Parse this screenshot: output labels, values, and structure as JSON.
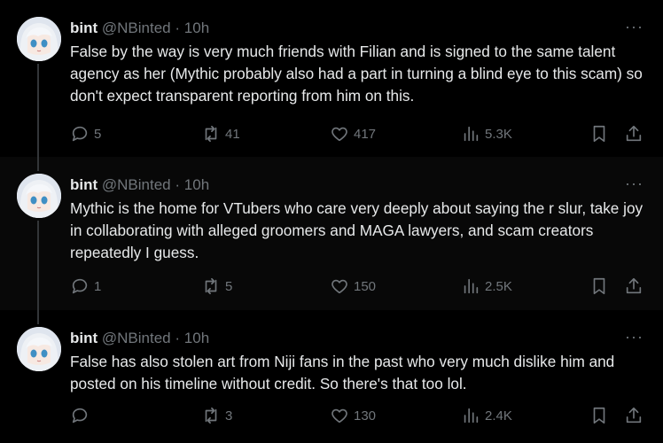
{
  "author": {
    "name": "bint",
    "handle": "@NBinted",
    "separator": "·"
  },
  "tweets": [
    {
      "time": "10h",
      "text": "False by the way is very much friends with Filian and is signed to the same talent agency as her (Mythic probably also had a part in turning a blind eye to this scam) so don't expect transparent reporting from him on this.",
      "replies": "5",
      "reposts": "41",
      "likes": "417",
      "views": "5.3K"
    },
    {
      "time": "10h",
      "text": "Mythic is the home for VTubers who care very deeply about saying the r slur, take joy in collaborating with alleged groomers and MAGA lawyers, and scam creators repeatedly I guess.",
      "replies": "1",
      "reposts": "5",
      "likes": "150",
      "views": "2.5K"
    },
    {
      "time": "10h",
      "text": "False has also stolen art from Niji fans in the past who very much dislike him and posted on his timeline without credit. So there's that too lol.",
      "replies": "",
      "reposts": "3",
      "likes": "130",
      "views": "2.4K"
    }
  ],
  "more_label": "···",
  "colors": {
    "background": "#000000",
    "text": "#e7e9ea",
    "muted": "#71767b",
    "avatar_bg": "#dfe5ee",
    "avatar_hair": "#eef1f5",
    "avatar_eyes": "#3f8fc4"
  },
  "icons": [
    "reply-icon",
    "repost-icon",
    "like-icon",
    "views-icon",
    "bookmark-icon",
    "share-icon",
    "more-icon",
    "avatar"
  ]
}
